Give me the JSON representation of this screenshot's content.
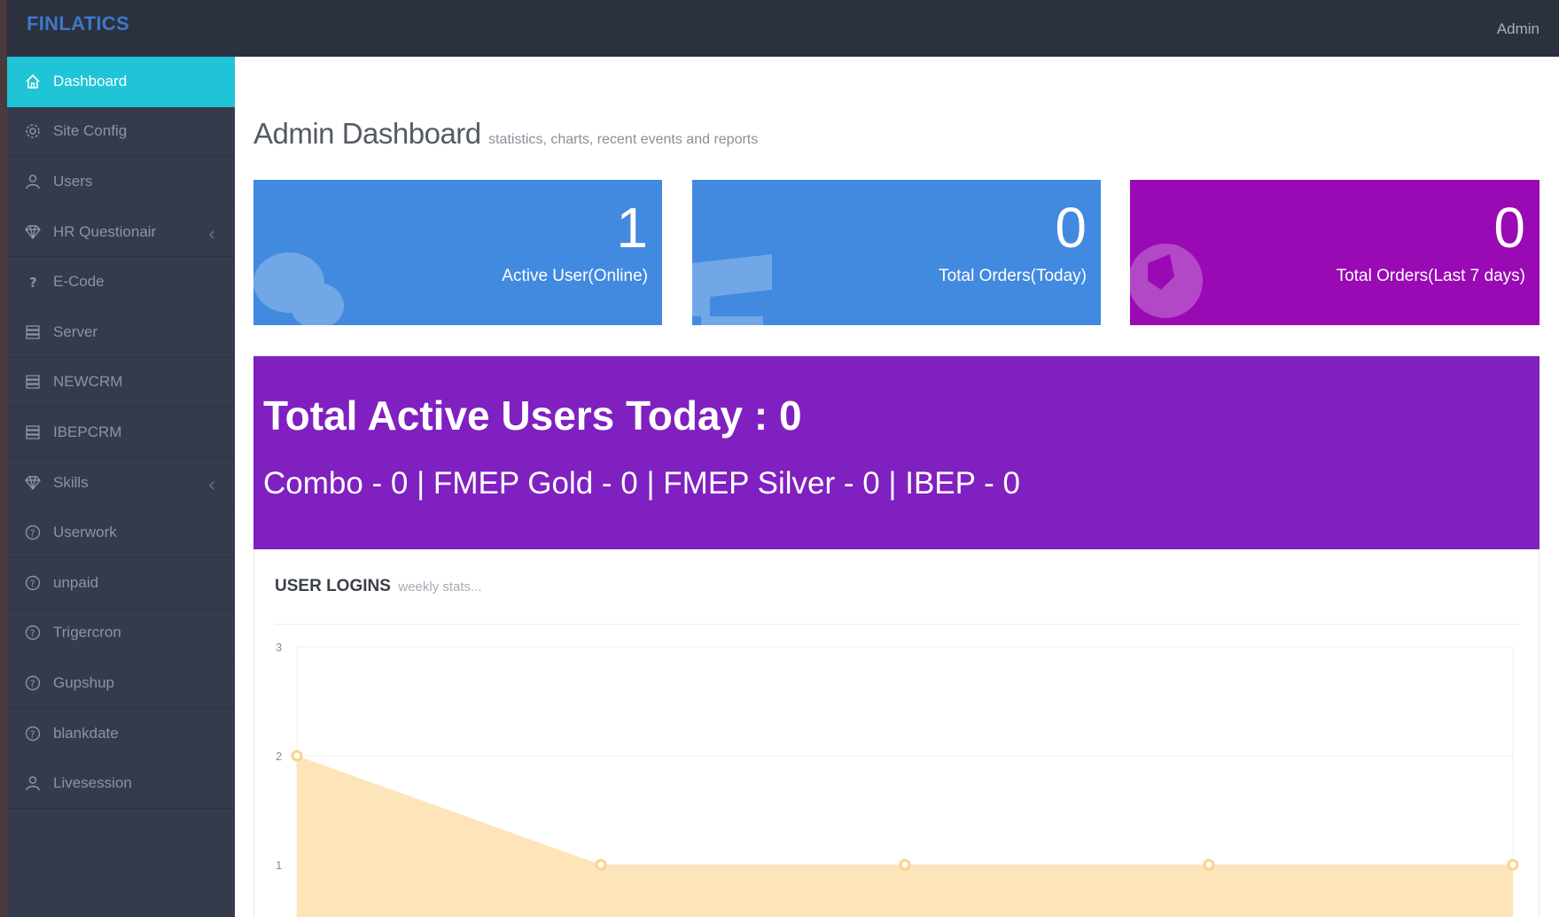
{
  "app": {
    "brand": "FINLATICS",
    "user": "Admin"
  },
  "sidebar": {
    "items": [
      {
        "label": "Dashboard",
        "icon": "home-icon"
      },
      {
        "label": "Site Config",
        "icon": "gear-icon"
      },
      {
        "label": "Users",
        "icon": "user-icon"
      },
      {
        "label": "HR Questionair",
        "icon": "diamond-icon"
      },
      {
        "label": "E-Code",
        "icon": "question-icon"
      },
      {
        "label": "Server",
        "icon": "server-icon"
      },
      {
        "label": "NEWCRM",
        "icon": "server-icon"
      },
      {
        "label": "IBEPCRM",
        "icon": "server-icon"
      },
      {
        "label": "Skills",
        "icon": "diamond-icon"
      },
      {
        "label": "Userwork",
        "icon": "help-circle-icon"
      },
      {
        "label": "unpaid",
        "icon": "help-circle-icon"
      },
      {
        "label": "Trigercron",
        "icon": "help-circle-icon"
      },
      {
        "label": "Gupshup",
        "icon": "help-circle-icon"
      },
      {
        "label": "blankdate",
        "icon": "help-circle-icon"
      },
      {
        "label": "Livesession",
        "icon": "user-icon"
      }
    ]
  },
  "page": {
    "title": "Admin Dashboard",
    "subtitle": "statistics, charts, recent events and reports"
  },
  "stats": [
    {
      "value": "1",
      "label": "Active User(Online)",
      "color": "#428ae0",
      "icon": "comments-icon"
    },
    {
      "value": "0",
      "label": "Total Orders(Today)",
      "color": "#428ae0",
      "icon": "bar-chart-icon"
    },
    {
      "value": "0",
      "label": "Total Orders(Last 7 days)",
      "color": "#9a0ab4",
      "icon": "globe-icon"
    }
  ],
  "banner": {
    "title": "Total Active Users Today : 0",
    "breakdown": "Combo - 0 | FMEP Gold - 0 | FMEP Silver - 0 | IBEP - 0",
    "color": "#8020c0"
  },
  "logins": {
    "title": "USER LOGINS",
    "subtitle": "weekly stats..."
  },
  "chart_data": {
    "type": "area",
    "x": [
      1,
      2,
      3,
      4,
      5
    ],
    "values": [
      2,
      1,
      1,
      1,
      1
    ],
    "y_ticks": [
      "1",
      "2",
      "3"
    ],
    "ylim": [
      1,
      3
    ],
    "fill_color": "#fde5b9",
    "point_color": "#f9d38e",
    "grid": true
  }
}
